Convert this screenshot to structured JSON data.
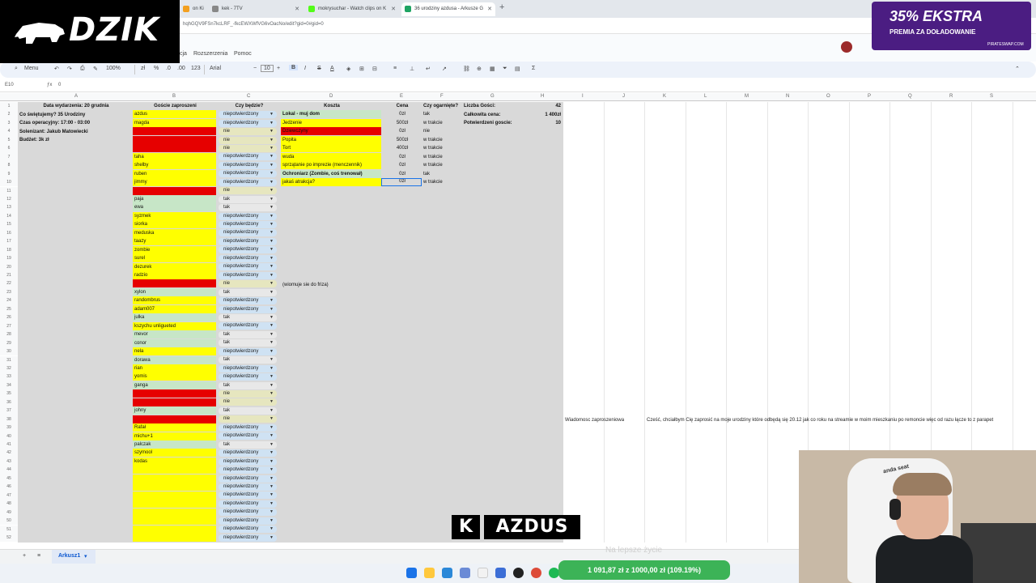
{
  "browser": {
    "tabs": [
      {
        "label": "on Ki",
        "color": "#f3a020"
      },
      {
        "label": "kek - 7TV",
        "color": "#888888"
      },
      {
        "label": "mokrysuchar - Watch clips on K",
        "color": "#53fc18"
      },
      {
        "label": "36 urodziny azdusa - Arkusze G",
        "color": "#1fa463"
      }
    ],
    "new_tab": "+",
    "url": "hqhGQV9FSn7kcLRF_-fkcEWXWfVG6vOacNo/edit?gid=0#gid=0"
  },
  "logo": {
    "text": "DZIK"
  },
  "sheets_menu": {
    "items": [
      "cja",
      "Rozszerzenia",
      "Pomoc"
    ]
  },
  "toolbar": {
    "menu": "Menu",
    "zoom": "100%",
    "currency": "zł",
    "percent": "%",
    "dec_less": ".0",
    "dec_more": ".00",
    "num_format": "123",
    "font": "Arial",
    "font_size": "10",
    "bold": "B",
    "italic": "I",
    "strike": "S",
    "color_a": "A"
  },
  "formula": {
    "cell_ref": "E10",
    "value": "0"
  },
  "columns": [
    "A",
    "B",
    "C",
    "D",
    "E",
    "F",
    "G",
    "H",
    "I",
    "J",
    "K",
    "L",
    "M",
    "N",
    "O",
    "P",
    "Q",
    "R",
    "S"
  ],
  "info": {
    "a1": "Data wydarzenia: 20 grudnia",
    "a2": "Co świętujemy? 35 Urodziny",
    "a3": "Czas operacyjny: 17:00 - 03:00",
    "a4": "Solenizant: Jakub Matowiecki",
    "a5": "Budżet: 3k zł"
  },
  "headers": {
    "b": "Goście zaproszeni",
    "c": "Czy będzie?",
    "d": "Koszta",
    "e": "Cena",
    "f": "Czy ogarnięte?",
    "g1": "Liczba Gości:",
    "h1": "42",
    "g2": "Całkowita cena:",
    "h2": "1 400zł",
    "g3": "Potwierdzeni goscie:",
    "h3": "10"
  },
  "guests": [
    {
      "name": "azdus",
      "status": "niepotwierdzony"
    },
    {
      "name": "magda",
      "status": "niepotwierdzony"
    },
    {
      "name": "",
      "status": "nie"
    },
    {
      "name": "",
      "status": "nie"
    },
    {
      "name": "",
      "status": "nie"
    },
    {
      "name": "taha",
      "status": "niepotwierdzony"
    },
    {
      "name": "shelby",
      "status": "niepotwierdzony"
    },
    {
      "name": "ruben",
      "status": "niepotwierdzony"
    },
    {
      "name": "jimmy",
      "status": "niepotwierdzony"
    },
    {
      "name": "",
      "status": "nie"
    },
    {
      "name": "paja",
      "status": "tak"
    },
    {
      "name": "ewa",
      "status": "tak"
    },
    {
      "name": "syzmek",
      "status": "niepotwierdzony"
    },
    {
      "name": "siorka",
      "status": "niepotwierdzony"
    },
    {
      "name": "meduska",
      "status": "niepotwierdzony"
    },
    {
      "name": "taazy",
      "status": "niepotwierdzony"
    },
    {
      "name": "zombie",
      "status": "niepotwierdzony"
    },
    {
      "name": "surel",
      "status": "niepotwierdzony"
    },
    {
      "name": "dezurek",
      "status": "niepotwierdzony"
    },
    {
      "name": "radzio",
      "status": "niepotwierdzony"
    },
    {
      "name": "",
      "status": "nie"
    },
    {
      "name": "xylon",
      "status": "tak"
    },
    {
      "name": "randombrus",
      "status": "niepotwierdzony"
    },
    {
      "name": "adam007",
      "status": "niepotwierdzony"
    },
    {
      "name": "julka",
      "status": "tak"
    },
    {
      "name": "kszychu unligueted",
      "status": "niepotwierdzony"
    },
    {
      "name": "mevor",
      "status": "tak"
    },
    {
      "name": "conor",
      "status": "tak"
    },
    {
      "name": "nela",
      "status": "niepotwierdzony"
    },
    {
      "name": "dorawa",
      "status": "tak"
    },
    {
      "name": "rian",
      "status": "niepotwierdzony"
    },
    {
      "name": "yomis",
      "status": "niepotwierdzony"
    },
    {
      "name": "ganga",
      "status": "tak"
    },
    {
      "name": "",
      "status": "nie"
    },
    {
      "name": "",
      "status": "nie"
    },
    {
      "name": "johny",
      "status": "tak"
    },
    {
      "name": "",
      "status": "nie"
    },
    {
      "name": "Rafał",
      "status": "niepotwierdzony"
    },
    {
      "name": "michu+1",
      "status": "niepotwierdzony"
    },
    {
      "name": "palczak",
      "status": "tak"
    },
    {
      "name": "szymool",
      "status": "niepotwierdzony"
    },
    {
      "name": "kodas",
      "status": "niepotwierdzony"
    },
    {
      "name": "",
      "status": "niepotwierdzony"
    },
    {
      "name": "",
      "status": "niepotwierdzony"
    },
    {
      "name": "",
      "status": "niepotwierdzony"
    },
    {
      "name": "",
      "status": "niepotwierdzony"
    },
    {
      "name": "",
      "status": "niepotwierdzony"
    },
    {
      "name": "",
      "status": "niepotwierdzony"
    },
    {
      "name": "",
      "status": "niepotwierdzony"
    },
    {
      "name": "",
      "status": "niepotwierdzony"
    },
    {
      "name": "",
      "status": "niepotwierdzony"
    }
  ],
  "costs": [
    {
      "item": "Lokal - muj dom",
      "price": "0zł",
      "done": "tak",
      "color": "#c7e6c7"
    },
    {
      "item": "Jedzenie",
      "price": "500zł",
      "done": "w trakcie",
      "color": "#ffff00"
    },
    {
      "item": "Dziewczyny",
      "price": "0zł",
      "done": "nie",
      "color": "#e60000"
    },
    {
      "item": "Popita",
      "price": "500zł",
      "done": "w trakcie",
      "color": "#ffff00"
    },
    {
      "item": "Tort",
      "price": "400zł",
      "done": "w trakcie",
      "color": "#ffff00"
    },
    {
      "item": "wuda",
      "price": "0zł",
      "done": "w trakcie",
      "color": "#ffff00"
    },
    {
      "item": "sprzątanie po imprezie (menczennik)",
      "price": "0zł",
      "done": "w trakcie",
      "color": "#ffff00"
    },
    {
      "item": "Ochroniarz (Zombie, coś trenował)",
      "price": "0zł",
      "done": "tak",
      "color": "#c7e6c7"
    },
    {
      "item": "jakaś atrakcja?",
      "price": "0zł",
      "done": "w trakcie",
      "color": "#ffff00"
    }
  ],
  "note_d22": "(wiomuje sie do friza)",
  "message": {
    "label": "Wiadomosc zaproszeniowa",
    "text": "Cześć, chciałbym Cię zaprosić na moje urodziny które odbędą się 20.12 jak co roku na streamie w moim mieszkaniu po remoncie więc od razu łącze to z parapet"
  },
  "sheet_tab": "Arkusz1",
  "promo": {
    "big": "35% EKSTRA",
    "small": "PREMIA ZA DOŁADOWANIE",
    "site": "PIRATESWAP.COM"
  },
  "overlay": {
    "badge_letter": "K",
    "badge_name": "AZDUS",
    "tagline": "Na lepsze życie",
    "goal": "1 091,87 zł z 1000,00 zł (109.19%)"
  },
  "webcam": {
    "chair_text": "anda seat"
  },
  "colors": {
    "yellow": "#ffff00",
    "red": "#e60000",
    "green": "#c7e6c7",
    "gray": "#d9d9d9"
  }
}
